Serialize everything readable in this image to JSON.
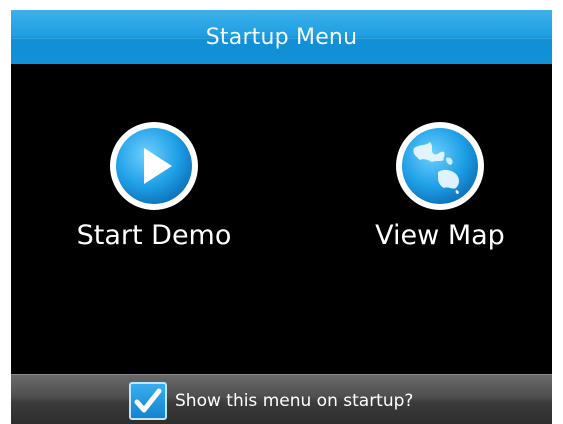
{
  "header": {
    "title": "Startup Menu"
  },
  "menu": {
    "items": [
      {
        "label": "Start Demo",
        "icon": "play-icon"
      },
      {
        "label": "View Map",
        "icon": "globe-icon"
      }
    ]
  },
  "footer": {
    "checkbox_label": "Show this menu on startup?",
    "checkbox_checked": true,
    "checkbox_icon": "checkmark-icon"
  },
  "colors": {
    "accent_blue": "#1d9ee2",
    "background": "#000000",
    "footer_gray": "#4e4e4e"
  }
}
